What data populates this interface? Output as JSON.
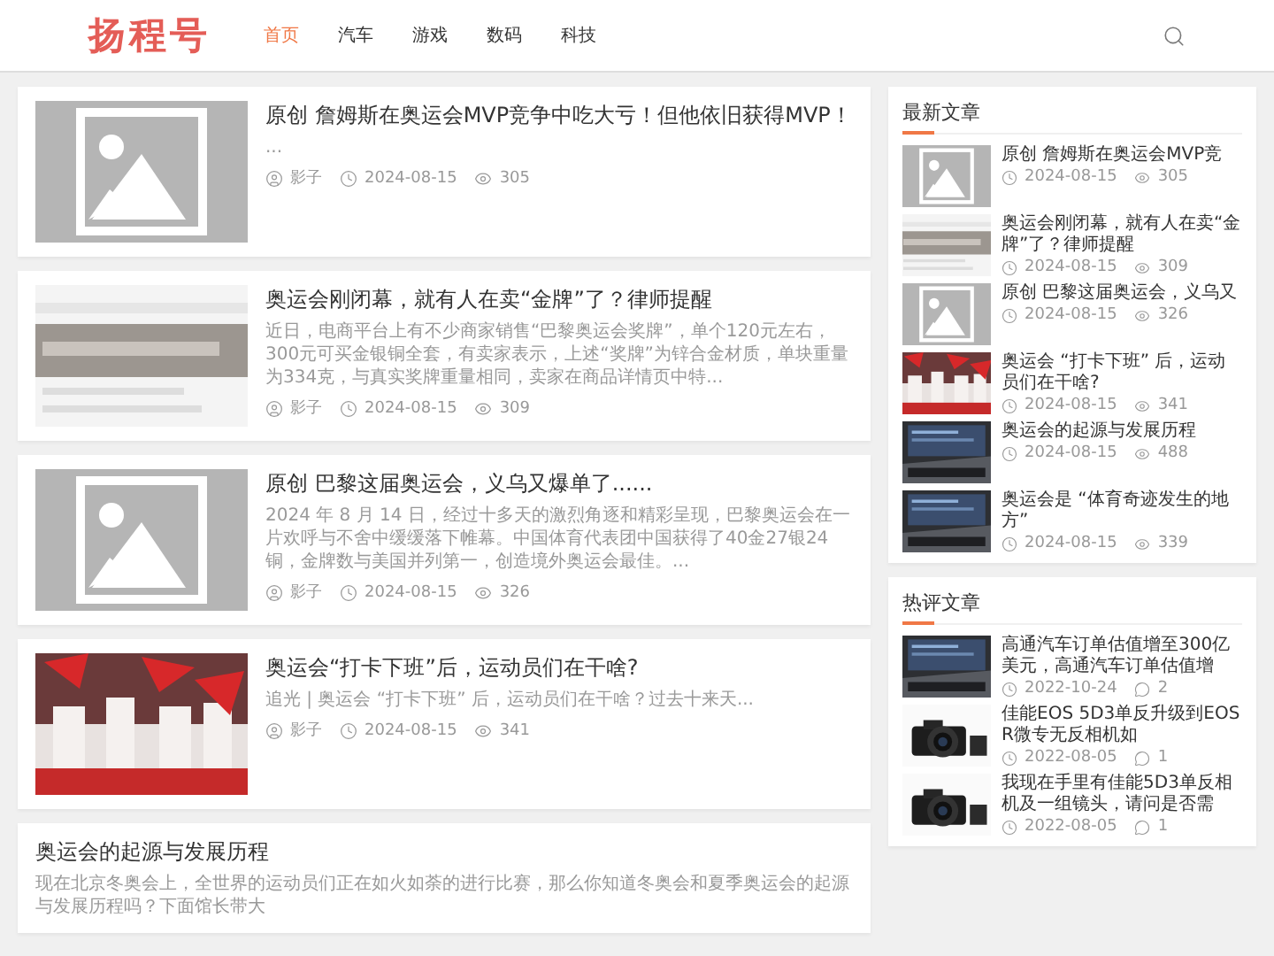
{
  "header": {
    "logo": "扬程号",
    "nav": [
      {
        "label": "首页",
        "selected": true
      },
      {
        "label": "汽车",
        "selected": false
      },
      {
        "label": "游戏",
        "selected": false
      },
      {
        "label": "数码",
        "selected": false
      },
      {
        "label": "科技",
        "selected": false
      }
    ]
  },
  "articles": [
    {
      "thumb": {
        "kind": "placeholder"
      },
      "title": "原创 詹姆斯在奥运会MVP竞争中吃大亏！但他依旧获得MVP！",
      "excerpt": "...",
      "author": "影子",
      "date": "2024-08-15",
      "views": "305"
    },
    {
      "thumb": {
        "kind": "paper"
      },
      "title": "奥运会刚闭幕，就有人在卖“金牌”了？律师提醒",
      "excerpt": "近日，电商平台上有不少商家销售“巴黎奥运会奖牌”，单个120元左右，300元可买金银铜全套，有卖家表示，上述“奖牌”为锌合金材质，单块重量为334克，与真实奖牌重量相同，卖家在商品详情页中特...",
      "author": "影子",
      "date": "2024-08-15",
      "views": "309"
    },
    {
      "thumb": {
        "kind": "placeholder"
      },
      "title": "原创 巴黎这届奥运会，义乌又爆单了......",
      "excerpt": "2024 年 8 月 14 日，经过十多天的激烈角逐和精彩呈现，巴黎奥运会在一片欢呼与不舍中缓缓落下帷幕。中国体育代表团中国获得了40金27银24铜，金牌数与美国并列第一，创造境外奥运会最佳。...",
      "author": "影子",
      "date": "2024-08-15",
      "views": "326"
    },
    {
      "thumb": {
        "kind": "crowd"
      },
      "title": "奥运会“打卡下班”后，运动员们在干啥?",
      "excerpt": "追光 | 奥运会 “打卡下班” 后，运动员们在干啥？过去十来天...",
      "author": "影子",
      "date": "2024-08-15",
      "views": "341"
    },
    {
      "title": "奥运会的起源与发展历程",
      "excerpt": "现在北京冬奥会上，全世界的运动员们正在如火如荼的进行比赛，那么你知道冬奥会和夏季奥运会的起源与发展历程吗？下面馆长带大"
    }
  ],
  "sidebar": [
    {
      "heading": "最新文章",
      "items": [
        {
          "thumb": {
            "kind": "placeholder"
          },
          "title": "原创 詹姆斯在奥运会MVP竞",
          "date": "2024-08-15",
          "kind": "views",
          "count": "305"
        },
        {
          "thumb": {
            "kind": "paper"
          },
          "title": "奥运会刚闭幕，就有人在卖“金牌”了？律师提醒",
          "date": "2024-08-15",
          "kind": "views",
          "count": "309"
        },
        {
          "thumb": {
            "kind": "placeholder"
          },
          "title": "原创 巴黎这届奥运会，义乌又",
          "date": "2024-08-15",
          "kind": "views",
          "count": "326"
        },
        {
          "thumb": {
            "kind": "crowd"
          },
          "title": "奥运会 “打卡下班” 后，运动员们在干啥?",
          "date": "2024-08-15",
          "kind": "views",
          "count": "341"
        },
        {
          "thumb": {
            "kind": "laptop"
          },
          "title": "奥运会的起源与发展历程",
          "date": "2024-08-15",
          "kind": "views",
          "count": "488"
        },
        {
          "thumb": {
            "kind": "laptop"
          },
          "title": "奥运会是 “体育奇迹发生的地方”",
          "date": "2024-08-15",
          "kind": "views",
          "count": "339"
        }
      ]
    },
    {
      "heading": "热评文章",
      "items": [
        {
          "thumb": {
            "kind": "laptop"
          },
          "title": "高通汽车订单估值增至300亿美元，高通汽车订单估值增",
          "date": "2022-10-24",
          "kind": "comments",
          "count": "2"
        },
        {
          "thumb": {
            "kind": "camera"
          },
          "title": "佳能EOS 5D3单反升级到EOS R微专无反相机如",
          "date": "2022-08-05",
          "kind": "comments",
          "count": "1"
        },
        {
          "thumb": {
            "kind": "camera"
          },
          "title": "我现在手里有佳能5D3单反相机及一组镜头，请问是否需",
          "date": "2022-08-05",
          "kind": "comments",
          "count": "1"
        }
      ]
    }
  ]
}
